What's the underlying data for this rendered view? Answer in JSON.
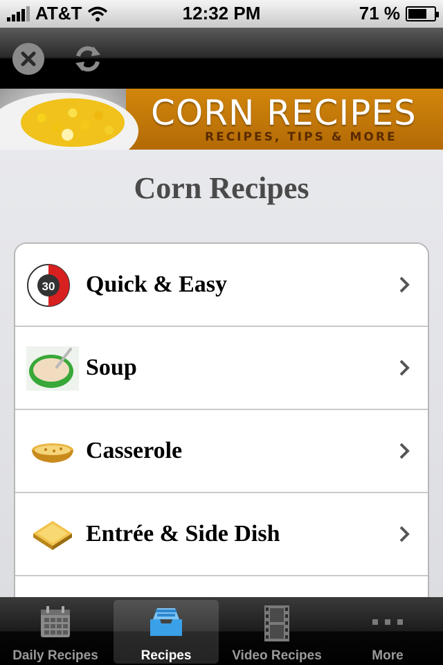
{
  "status_bar": {
    "carrier": "AT&T",
    "time": "12:32 PM",
    "battery_percent": "71 %",
    "battery_level": 0.71
  },
  "toolbar": {
    "close_icon": "close-icon",
    "refresh_icon": "refresh-icon"
  },
  "banner": {
    "title": "CORN RECIPES",
    "subtitle": "RECIPES, TIPS & MORE"
  },
  "page": {
    "title": "Corn Recipes"
  },
  "categories": [
    {
      "label": "Quick & Easy",
      "icon": "timer-icon"
    },
    {
      "label": "Soup",
      "icon": "soup-bowl-icon"
    },
    {
      "label": "Casserole",
      "icon": "casserole-icon"
    },
    {
      "label": "Entrée & Side Dish",
      "icon": "sandwich-icon"
    }
  ],
  "tabs": [
    {
      "label": "Daily Recipes",
      "icon": "calendar-icon",
      "active": false
    },
    {
      "label": "Recipes",
      "icon": "inbox-tray-icon",
      "active": true
    },
    {
      "label": "Video Recipes",
      "icon": "film-strip-icon",
      "active": false
    },
    {
      "label": "More",
      "icon": "more-dots-icon",
      "active": false
    }
  ],
  "colors": {
    "banner_orange": "#c47a08",
    "tab_active_blue": "#3aa0e8",
    "timer_red": "#d82020"
  }
}
